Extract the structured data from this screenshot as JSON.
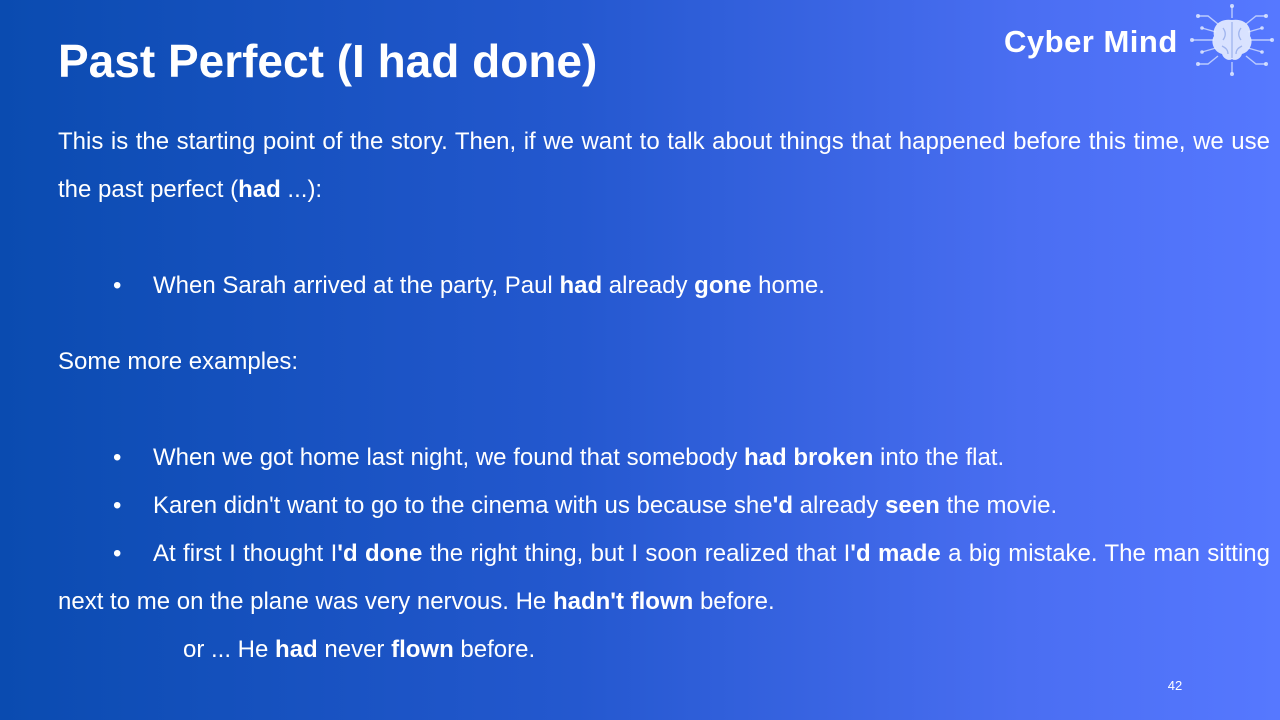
{
  "slide": {
    "title": "Past Perfect (I had done)",
    "logo": {
      "text": "Cyber Mind",
      "icon": "brain-circuit-icon"
    },
    "intro": {
      "part1": " This is the starting point of the story. Then, if we want to talk about things that happened before this time, we use the past perfect (",
      "bold": "had",
      "part2": " ...):"
    },
    "example1": {
      "bullet": "•",
      "p1": "When Sarah arrived at the party, Paul ",
      "b1": "had",
      "p2": " already ",
      "b2": "gone",
      "p3": " home."
    },
    "more_heading": "Some more examples:",
    "examples": [
      {
        "bullet": "•",
        "p1": "When we got home last night, we found that somebody ",
        "b1": "had broken",
        "p2": " into the flat."
      },
      {
        "bullet": "•",
        "p1": "Karen didn't want to go to the cinema with us because she",
        "b1": "'d",
        "p2": " already ",
        "b2": "seen",
        "p3": " the movie."
      },
      {
        "bullet": "•",
        "p1": "At first I thought I",
        "b1": "'d done",
        "p2": " the right thing, but I soon realized that I",
        "b2": "'d made",
        "p3": " a big mistake. The man sitting next to me on the plane was very nervous. He ",
        "b3": "hadn't flown",
        "p4": " before."
      }
    ],
    "alt_line": {
      "p1": "or ... He ",
      "b1": "had",
      "p2": " never ",
      "b2": "flown",
      "p3": " before."
    },
    "page_number": "42",
    "colors": {
      "background_left": "#0a4bb0",
      "background_right": "#5678ff",
      "text": "#ffffff"
    }
  }
}
